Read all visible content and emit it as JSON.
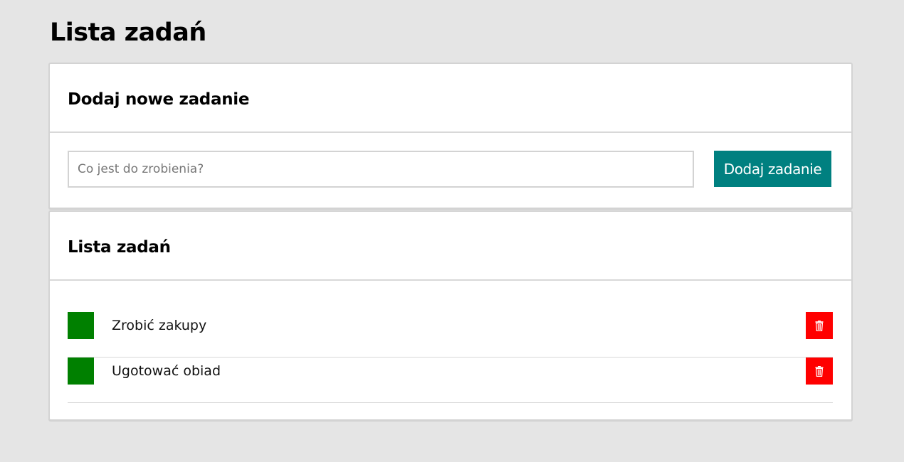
{
  "page": {
    "title": "Lista zadań"
  },
  "add_section": {
    "title": "Dodaj nowe zadanie",
    "input_value": "",
    "input_placeholder": "Co jest do zrobienia?",
    "button_label": "Dodaj zadanie"
  },
  "list_section": {
    "title": "Lista zadań",
    "tasks": [
      {
        "label": "Zrobić zakupy",
        "done_icon": "green-checkbox",
        "delete_icon": "trash-icon"
      },
      {
        "label": "Ugotować obiad",
        "done_icon": "green-checkbox",
        "delete_icon": "trash-icon"
      }
    ]
  },
  "colors": {
    "background": "#e5e5e5",
    "accent_button": "#008080",
    "checkbox": "#008000",
    "delete": "#ff0000"
  }
}
